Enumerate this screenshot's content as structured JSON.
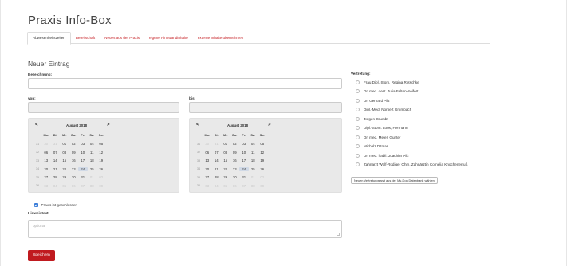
{
  "page": {
    "title": "Praxis Info-Box"
  },
  "tabs": [
    {
      "label": "Abwesenheitszeiten",
      "active": true
    },
    {
      "label": "Bereitschaft",
      "active": false
    },
    {
      "label": "Neues aus der Praxis",
      "active": false
    },
    {
      "label": "eigene Pinnwandinhalte",
      "active": false
    },
    {
      "label": "externe Inhalte übernehmen",
      "active": false
    }
  ],
  "form": {
    "section_title": "Neuer Eintrag",
    "bezeichnung_label": "Bezeichnung:",
    "bezeichnung_value": "",
    "von_label": "von:",
    "von_value": "",
    "bis_label": "bis:",
    "bis_value": "",
    "checkbox_label": "Praxis ist geschlossen",
    "checkbox_checked": true,
    "hinweis_label": "Hinweistext:",
    "hinweis_placeholder": "optional",
    "save_label": "Speichern"
  },
  "calendar": {
    "prev": "<",
    "next": ">",
    "month_label": "August 2018",
    "weekdays": [
      "Mo.",
      "Di.",
      "Mi.",
      "Do.",
      "Fr.",
      "Sa.",
      "So."
    ],
    "weeks": [
      {
        "wk": "31",
        "days": [
          "30",
          "31",
          "01",
          "02",
          "03",
          "04",
          "05"
        ]
      },
      {
        "wk": "32",
        "days": [
          "06",
          "07",
          "08",
          "09",
          "10",
          "11",
          "12"
        ]
      },
      {
        "wk": "33",
        "days": [
          "13",
          "14",
          "15",
          "16",
          "17",
          "18",
          "19"
        ]
      },
      {
        "wk": "34",
        "days": [
          "20",
          "21",
          "22",
          "23",
          "24",
          "25",
          "26"
        ]
      },
      {
        "wk": "35",
        "days": [
          "27",
          "28",
          "29",
          "30",
          "31",
          "01",
          "02"
        ]
      },
      {
        "wk": "36",
        "days": [
          "03",
          "04",
          "05",
          "06",
          "07",
          "08",
          "09"
        ]
      }
    ],
    "today": "24"
  },
  "vertretung": {
    "title": "Vertretung:",
    "options": [
      "Frau Dipl.-Stom. Regina Rotschke",
      "Dr. med. dent. Julia Felten-Seifert",
      "Dr. Gerhard Pilz",
      "Dipl.-Med. Norbert Grumbach",
      "Jürgen Grumbt",
      "Dipl.-Stom. Loos, Hermann",
      "Dr. med. Meier, Gunter",
      "Michelz Ditmar",
      "Dr. med. habil. Joachim Pilz",
      "Zahnarzt Wolf-Rüdiger Ohm, Zahnärztin Cornelia Knochenerruß"
    ],
    "add_button": "Neuen Vertretungsarzt aus der My-Doc Datenbank wählen"
  },
  "colors": {
    "accent": "#c01a1f",
    "tab_link": "#c7252a",
    "calendar_bg": "#e9e9e9",
    "checkbox": "#3b7dd8"
  }
}
